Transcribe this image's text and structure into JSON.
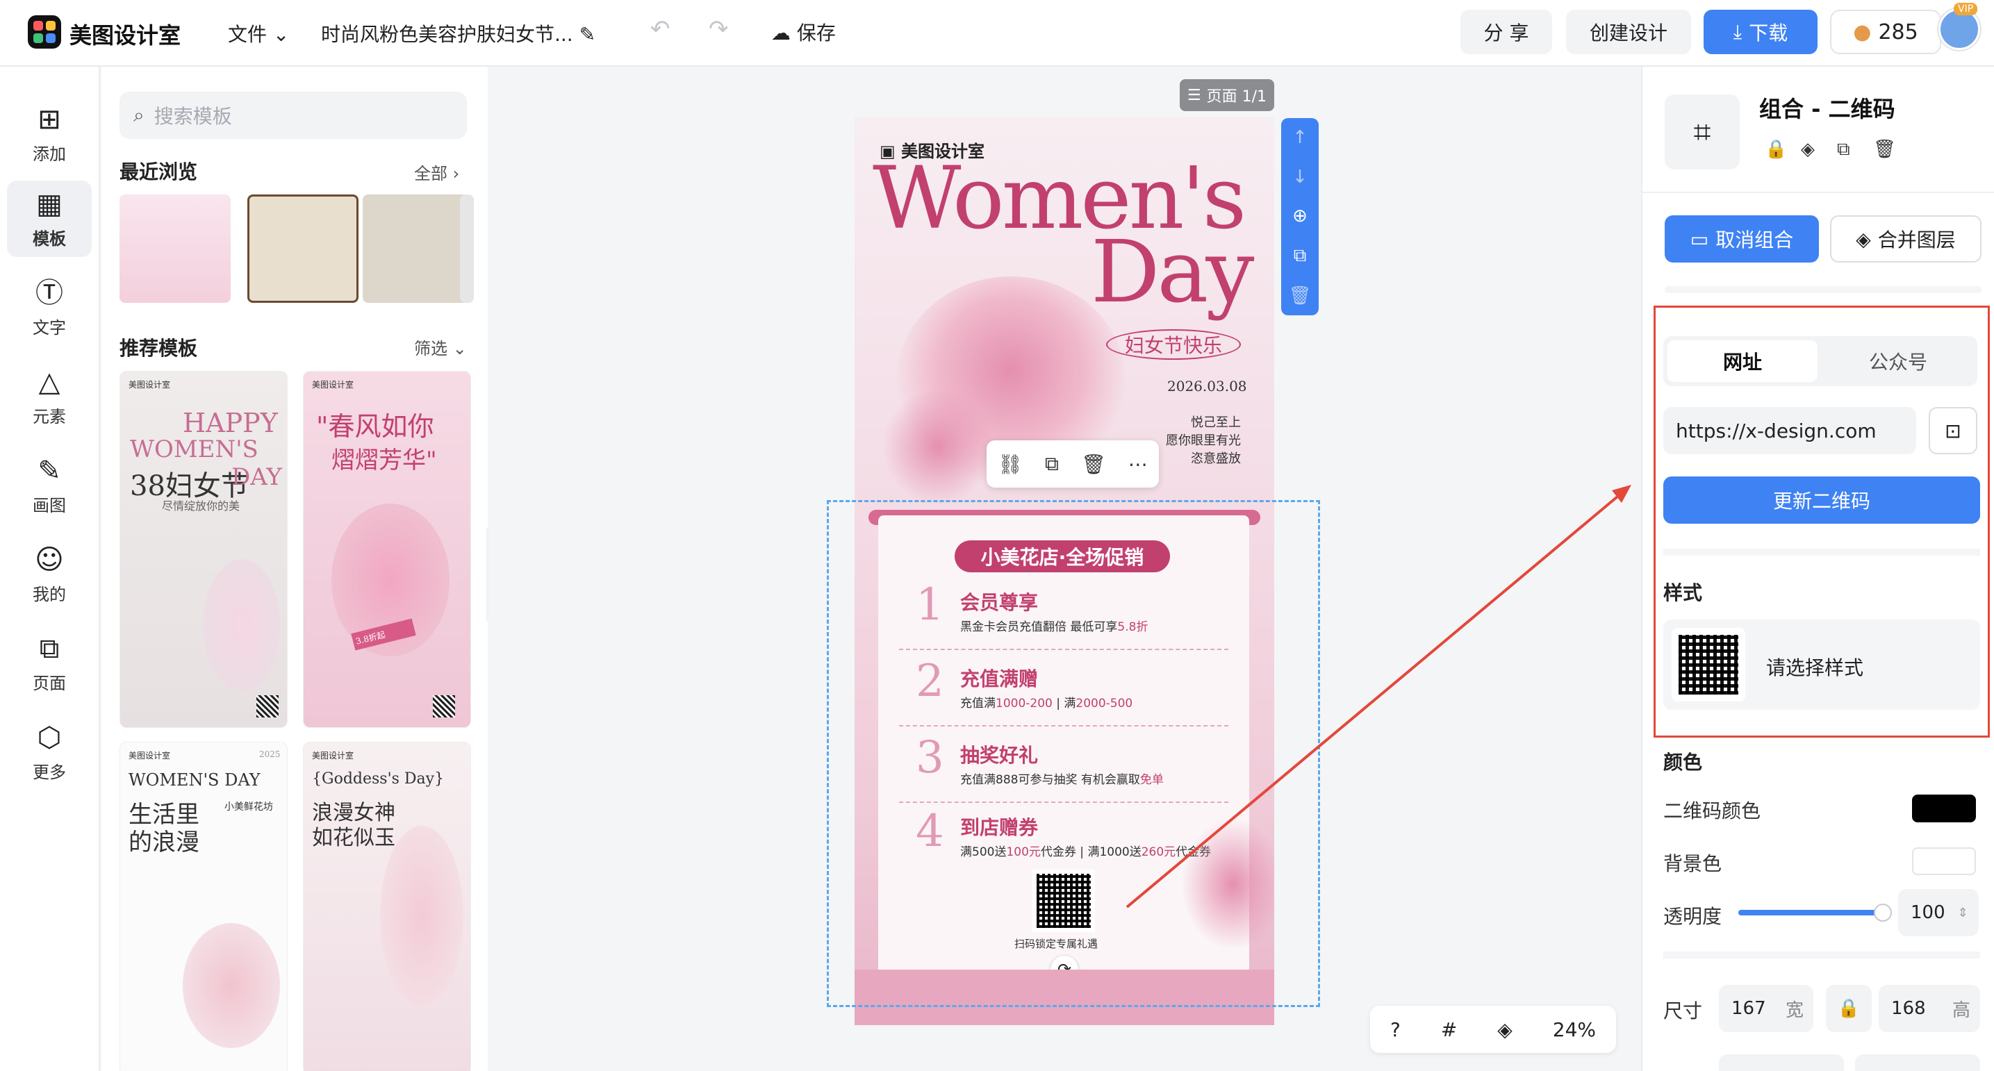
{
  "header": {
    "brand": "美图设计室",
    "file_menu": "文件",
    "doc_title": "时尚风粉色美容护肤妇女节...",
    "save": "保存",
    "share": "分 享",
    "create": "创建设计",
    "download": "下载",
    "credits": "285",
    "vip": "VIP"
  },
  "nav": [
    {
      "label": "添加",
      "icon": "plus-square-icon"
    },
    {
      "label": "模板",
      "icon": "template-icon"
    },
    {
      "label": "文字",
      "icon": "text-icon"
    },
    {
      "label": "元素",
      "icon": "shapes-icon"
    },
    {
      "label": "画图",
      "icon": "draw-icon"
    },
    {
      "label": "我的",
      "icon": "user-icon"
    },
    {
      "label": "页面",
      "icon": "page-icon"
    },
    {
      "label": "更多",
      "icon": "cube-icon"
    }
  ],
  "panel": {
    "search_placeholder": "搜索模板",
    "recent_title": "最近浏览",
    "recent_all": "全部",
    "recommend_title": "推荐模板",
    "filter": "筛选",
    "templates": [
      {
        "brand": "美图设计室",
        "line1": "HAPPY",
        "line2": "WOMEN'S",
        "line3": "38妇女节",
        "line3b": "DAY",
        "sub": "尽情绽放你的美"
      },
      {
        "brand": "美图设计室",
        "line1": "\"春风如你",
        "line2": "熠熠芳华\"",
        "badge": "3.8折起"
      },
      {
        "brand": "美图设计室",
        "year": "2025",
        "line1": "WOMEN'S DAY",
        "line2": "生活里",
        "line3": "的浪漫",
        "side": "小美鲜花坊"
      },
      {
        "brand": "美图设计室",
        "line1": "{Goddess's Day}",
        "line2": "浪漫女神",
        "line3": "如花似玉"
      }
    ]
  },
  "canvas": {
    "page_tag": "页面 1/1",
    "zoom": "24%",
    "poster": {
      "brand": "美图设计室",
      "title1": "Women's",
      "title2": "Day",
      "festival": "妇女节快乐",
      "date": "2026.03.08",
      "slogan": [
        "悦己至上",
        "愿你眼里有光",
        "恣意盛放"
      ],
      "banner": "小美花店·全场促销",
      "items": [
        {
          "num": "1",
          "title": "会员尊享",
          "desc": "黑金卡会员充值翻倍 最低可享",
          "hl": "5.8折",
          "desc2": ""
        },
        {
          "num": "2",
          "title": "充值满赠",
          "desc": "充值满",
          "hl": "1000-200",
          "desc2": " | 满",
          "hl2": "2000-500"
        },
        {
          "num": "3",
          "title": "抽奖好礼",
          "desc": "充值满888可参与抽奖 有机会赢取",
          "hl": "免单",
          "desc2": ""
        },
        {
          "num": "4",
          "title": "到店赠券",
          "desc": "满500送",
          "hl": "100元",
          "desc2": "代金券 | 满1000送",
          "hl2": "260元",
          "desc3": "代金券"
        }
      ],
      "qr_caption": "扫码锁定专属礼遇"
    }
  },
  "right": {
    "title": "组合 - 二维码",
    "ungroup": "取消组合",
    "merge": "合并图层",
    "tab_url": "网址",
    "tab_wechat": "公众号",
    "url_value": "https://x-design.com",
    "update_btn": "更新二维码",
    "style_title": "样式",
    "style_choose": "请选择样式",
    "color_title": "颜色",
    "qr_color_label": "二维码颜色",
    "bg_label": "背景色",
    "opacity_label": "透明度",
    "opacity_value": "100",
    "opacity_level": 1.0,
    "size_label": "尺寸",
    "width_value": "167",
    "width_unit": "宽",
    "height_value": "168",
    "height_unit": "高",
    "qr_color": "#000000",
    "bg_color": "#ffffff"
  },
  "colors": {
    "accent": "#3f82f3",
    "annotation": "#e3483a",
    "poster_pink": "#c2406e"
  }
}
